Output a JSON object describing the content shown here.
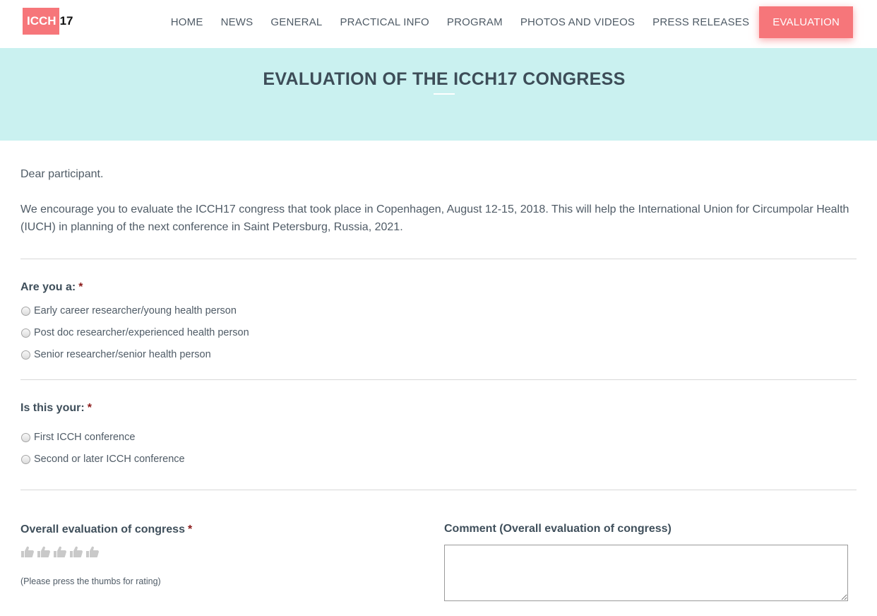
{
  "logo": {
    "box_text": "ICCH",
    "number": "17"
  },
  "nav": {
    "items": [
      "HOME",
      "NEWS",
      "GENERAL",
      "PRACTICAL INFO",
      "PROGRAM",
      "PHOTOS AND VIDEOS",
      "PRESS RELEASES"
    ],
    "active": "EVALUATION"
  },
  "banner": {
    "title": "EVALUATION OF THE ICCH17 CONGRESS"
  },
  "intro": {
    "greeting": "Dear participant.",
    "text": "We encourage you to evaluate the ICCH17 congress that took place in Copenhagen, August 12-15, 2018. This will help the International Union for Circumpolar Health (IUCH) in planning of the next conference in Saint Petersburg, Russia, 2021."
  },
  "q1": {
    "label": "Are you a:",
    "required": "*",
    "options": [
      "Early career researcher/young health person",
      "Post doc researcher/experienced health person",
      "Senior researcher/senior health person"
    ]
  },
  "q2": {
    "label": "Is this your:",
    "required": "*",
    "options": [
      "First ICCH conference",
      "Second or later ICCH conference"
    ]
  },
  "q3": {
    "label": "Overall evaluation of congress",
    "required": "*",
    "rating_icon": "thumbs-up-icon",
    "hint": "(Please press the thumbs for rating)",
    "comment_label": "Comment (Overall evaluation of congress)",
    "comment_value": ""
  },
  "colors": {
    "accent": "#f6767a",
    "banner_bg": "#caf1f0",
    "heading": "#3d4d58",
    "required": "#8b1a1a"
  }
}
